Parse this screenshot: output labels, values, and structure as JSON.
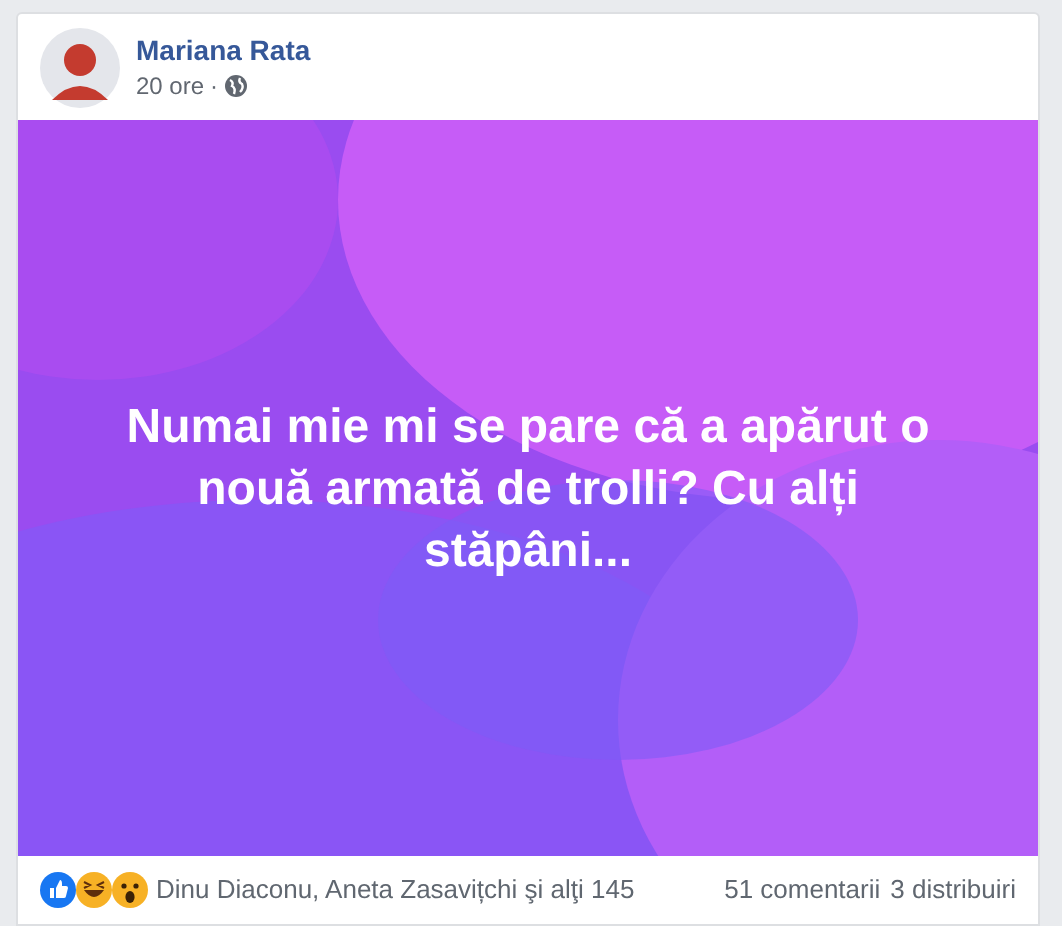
{
  "post": {
    "author": "Mariana Rata",
    "time": "20 ore",
    "separator": "·",
    "text": "Numai mie mi se pare că a apărut o nouă armată de trolli? Cu alți stăpâni...",
    "reactions_summary": "Dinu Diaconu, Aneta Zasavițchi şi alţi 145",
    "comments": "51 comentarii",
    "shares": "3 distribuiri"
  }
}
